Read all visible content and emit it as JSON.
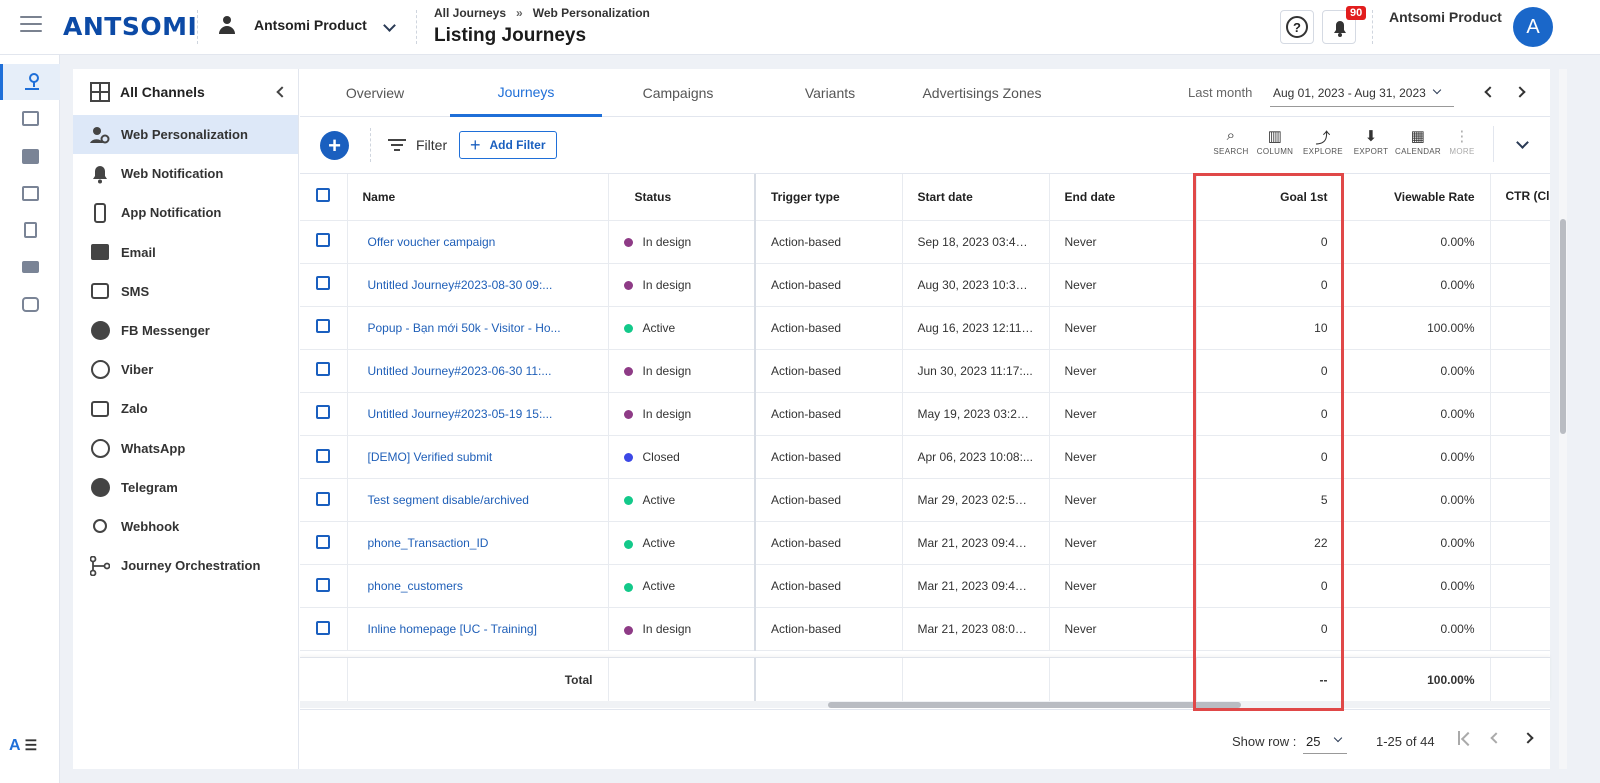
{
  "header": {
    "logo": "ANTSOMI",
    "account": "Antsomi Product",
    "breadcrumb": [
      "All Journeys",
      "»",
      "Web Personalization"
    ],
    "title": "Listing Journeys",
    "help_label": "?",
    "notification_count": "90",
    "user_name": "Antsomi Product",
    "avatar_letter": "A"
  },
  "rail": {
    "items": [
      "journey-icon",
      "data-icon",
      "ticket-icon",
      "media-icon",
      "report-icon",
      "mail-icon",
      "link-icon"
    ],
    "bottom_logo": "A",
    "bottom_menu": "☰"
  },
  "channels": {
    "header": "All Channels",
    "items": [
      {
        "label": "Web Personalization",
        "icon": "web-personalization-icon",
        "active": true
      },
      {
        "label": "Web Notification",
        "icon": "bell-icon"
      },
      {
        "label": "App Notification",
        "icon": "phone-icon"
      },
      {
        "label": "Email",
        "icon": "mail-icon"
      },
      {
        "label": "SMS",
        "icon": "sms-icon"
      },
      {
        "label": "FB Messenger",
        "icon": "facebook-icon"
      },
      {
        "label": "Viber",
        "icon": "viber-icon"
      },
      {
        "label": "Zalo",
        "icon": "zalo-icon"
      },
      {
        "label": "WhatsApp",
        "icon": "whatsapp-icon"
      },
      {
        "label": "Telegram",
        "icon": "telegram-icon"
      },
      {
        "label": "Webhook",
        "icon": "webhook-icon"
      },
      {
        "label": "Journey Orchestration",
        "icon": "orchestration-icon"
      }
    ]
  },
  "tabs": {
    "items": [
      "Overview",
      "Journeys",
      "Campaigns",
      "Variants",
      "Advertisings Zones"
    ],
    "active": "Journeys",
    "date_label": "Last month",
    "date_range": "Aug 01, 2023 - Aug 31, 2023"
  },
  "toolbar": {
    "add": "+",
    "filter": "Filter",
    "add_filter": "Add Filter",
    "tools": [
      {
        "label": "SEARCH",
        "icon": "search-icon"
      },
      {
        "label": "COLUMN",
        "icon": "column-icon"
      },
      {
        "label": "EXPLORE",
        "icon": "explore-icon"
      },
      {
        "label": "EXPORT",
        "icon": "export-icon"
      },
      {
        "label": "CALENDAR",
        "icon": "calendar-icon"
      },
      {
        "label": "MORE",
        "icon": "more-icon"
      }
    ]
  },
  "table": {
    "columns": [
      "Name",
      "Status",
      "Trigger type",
      "Start date",
      "End date",
      "Goal 1st",
      "Viewable Rate",
      "CTR (Cl Viewab"
    ],
    "rows": [
      {
        "name": "Offer voucher campaign",
        "status": "In design",
        "trigger": "Action-based",
        "start": "Sep 18, 2023 03:42:...",
        "end": "Never",
        "goal": "0",
        "viewable": "0.00%"
      },
      {
        "name": "Untitled Journey#2023-08-30 09:...",
        "status": "In design",
        "trigger": "Action-based",
        "start": "Aug 30, 2023 10:34:...",
        "end": "Never",
        "goal": "0",
        "viewable": "0.00%"
      },
      {
        "name": "Popup - Bạn mới 50k - Visitor - Ho...",
        "status": "Active",
        "trigger": "Action-based",
        "start": "Aug 16, 2023 12:11:...",
        "end": "Never",
        "goal": "10",
        "viewable": "100.00%"
      },
      {
        "name": "Untitled Journey#2023-06-30 11:...",
        "status": "In design",
        "trigger": "Action-based",
        "start": "Jun 30, 2023 11:17:...",
        "end": "Never",
        "goal": "0",
        "viewable": "0.00%"
      },
      {
        "name": "Untitled Journey#2023-05-19 15:...",
        "status": "In design",
        "trigger": "Action-based",
        "start": "May 19, 2023 03:26:...",
        "end": "Never",
        "goal": "0",
        "viewable": "0.00%"
      },
      {
        "name": "[DEMO] Verified submit",
        "status": "Closed",
        "trigger": "Action-based",
        "start": "Apr 06, 2023 10:08:...",
        "end": "Never",
        "goal": "0",
        "viewable": "0.00%"
      },
      {
        "name": "Test segment disable/archived",
        "status": "Active",
        "trigger": "Action-based",
        "start": "Mar 29, 2023 02:52:...",
        "end": "Never",
        "goal": "5",
        "viewable": "0.00%"
      },
      {
        "name": "phone_Transaction_ID",
        "status": "Active",
        "trigger": "Action-based",
        "start": "Mar 21, 2023 09:43:...",
        "end": "Never",
        "goal": "22",
        "viewable": "0.00%"
      },
      {
        "name": "phone_customers",
        "status": "Active",
        "trigger": "Action-based",
        "start": "Mar 21, 2023 09:43:...",
        "end": "Never",
        "goal": "0",
        "viewable": "0.00%"
      },
      {
        "name": "Inline homepage [UC - Training]",
        "status": "In design",
        "trigger": "Action-based",
        "start": "Mar 21, 2023 08:00:...",
        "end": "Never",
        "goal": "0",
        "viewable": "0.00%"
      }
    ],
    "status_colors": {
      "In design": "#8e3b86",
      "Active": "#13c98a",
      "Closed": "#3c48e6"
    },
    "total": {
      "label": "Total",
      "goal": "--",
      "viewable": "100.00%"
    }
  },
  "pager": {
    "show_row_label": "Show row :",
    "rows": "25",
    "range": "1-25 of 44"
  }
}
